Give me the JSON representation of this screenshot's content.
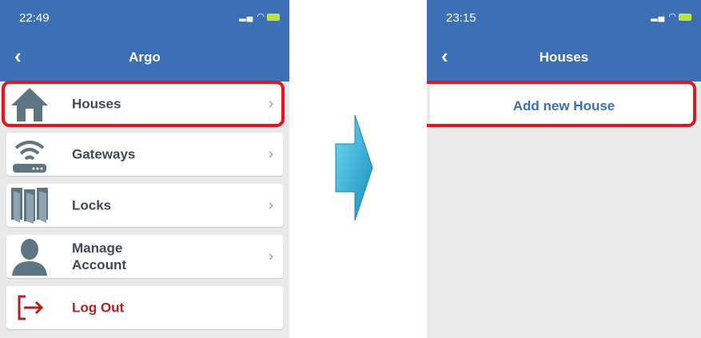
{
  "left_screen": {
    "status_time": "22:49",
    "title": "Argo",
    "items": [
      {
        "label": "Houses",
        "icon": "house-icon"
      },
      {
        "label": "Gateways",
        "icon": "wifi-router-icon"
      },
      {
        "label": "Locks",
        "icon": "doors-icon"
      },
      {
        "label": "Manage Account",
        "label_line1": "Manage",
        "label_line2": "Account",
        "icon": "person-icon"
      },
      {
        "label": "Log Out",
        "icon": "logout-icon"
      }
    ],
    "chevron": "›"
  },
  "right_screen": {
    "status_time": "23:15",
    "title": "Houses",
    "add_button_label": "Add new House"
  },
  "colors": {
    "header_blue": "#3c6fb6",
    "highlight_red": "#e8141b",
    "logout_red": "#b5201e",
    "icon_slate": "#5e7584",
    "arrow_blue": "#29b7de"
  }
}
